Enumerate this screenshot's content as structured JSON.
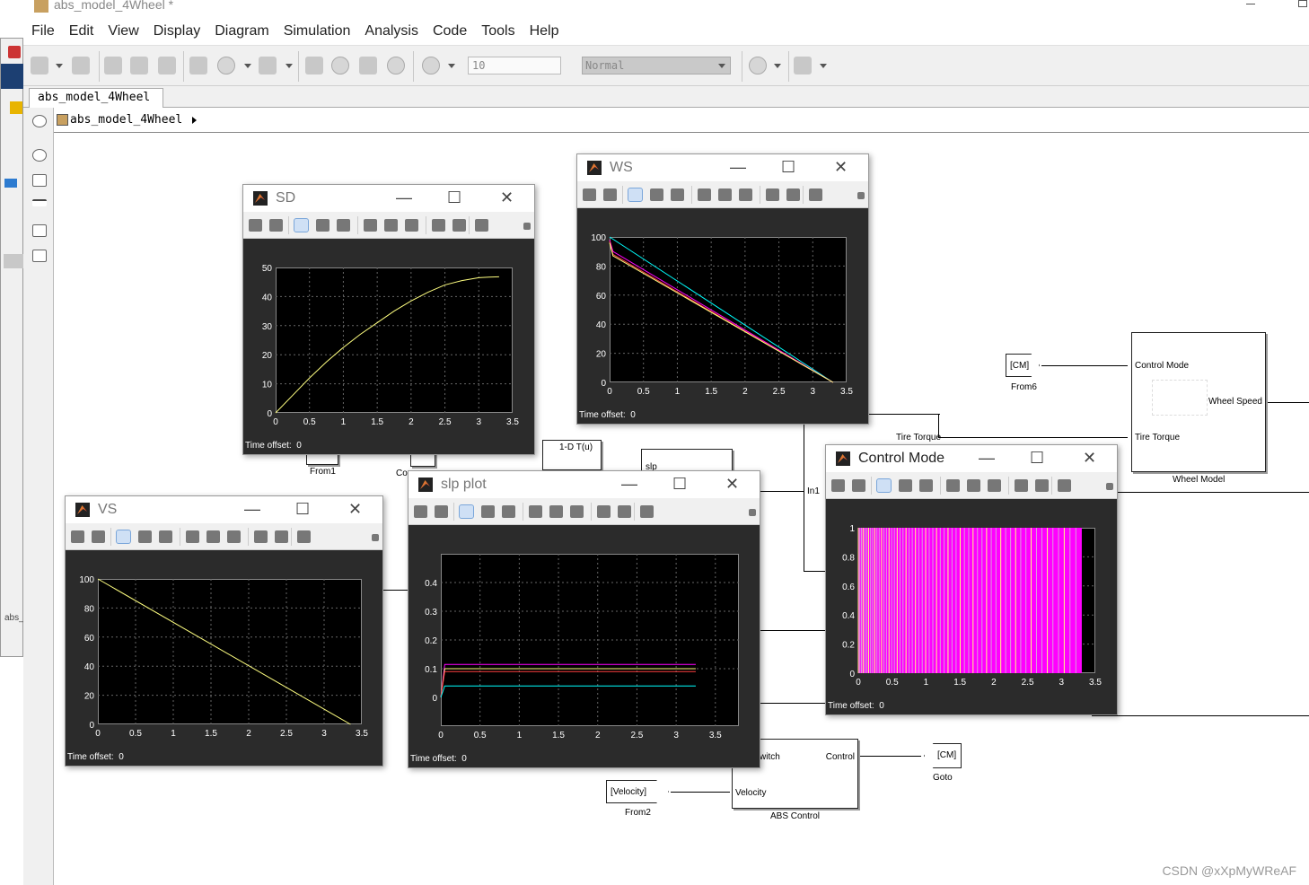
{
  "window": {
    "title": "abs_model_4Wheel *"
  },
  "menu": [
    "File",
    "Edit",
    "View",
    "Display",
    "Diagram",
    "Simulation",
    "Analysis",
    "Code",
    "Tools",
    "Help"
  ],
  "toolbar": {
    "stop_time": "10",
    "sim_mode": "Normal"
  },
  "tab": {
    "label": "abs_model_4Wheel"
  },
  "breadcrumb": {
    "label": "abs_model_4Wheel"
  },
  "blocks": {
    "from6_tag": "[CM]",
    "from6_name": "From6",
    "from1_name": "From1",
    "co_name": "Co",
    "lookup_label": "1-D T(u)",
    "slp_fragment": "slp",
    "in1": "In1",
    "tire_torque_sig": "Tire Torque",
    "wheel_model": {
      "name": "Wheel Model",
      "in1": "Control Mode",
      "in2": "Tire Torque",
      "out": "Wheel Speed"
    },
    "abs_control": {
      "name": "ABS Control",
      "in1": "witch",
      "in2": "Velocity",
      "out": "Control"
    },
    "goto": {
      "tag": "[CM]",
      "name": "Goto"
    },
    "from2": {
      "tag": "[Velocity]",
      "name": "From2"
    }
  },
  "scopes": {
    "sd": {
      "title": "SD",
      "offset_label": "Time offset:",
      "offset": "0"
    },
    "ws": {
      "title": "WS",
      "offset_label": "Time offset:",
      "offset": "0"
    },
    "vs": {
      "title": "VS",
      "offset_label": "Time offset:",
      "offset": "0"
    },
    "slp": {
      "title": "slp plot",
      "offset_label": "Time offset:",
      "offset": "0"
    },
    "cm": {
      "title": "Control Mode",
      "offset_label": "Time offset:",
      "offset": "0"
    }
  },
  "chart_data": [
    {
      "type": "line",
      "title": "SD",
      "xlim": [
        0,
        3.5
      ],
      "ylim": [
        0,
        50
      ],
      "x_ticks": [
        "0",
        "0.5",
        "1",
        "1.5",
        "2",
        "2.5",
        "3",
        "3.5"
      ],
      "y_ticks": [
        "0",
        "10",
        "20",
        "30",
        "40",
        "50"
      ],
      "grid": true,
      "colors": [
        "#ffff80"
      ],
      "series": [
        {
          "x": [
            0,
            0.25,
            0.5,
            0.75,
            1,
            1.25,
            1.5,
            1.75,
            2,
            2.25,
            2.5,
            2.75,
            3,
            3.15,
            3.3
          ],
          "values": [
            0,
            6,
            12,
            17.5,
            22.5,
            27,
            31,
            35,
            38.5,
            41.5,
            44,
            45.5,
            46.5,
            46.7,
            46.8
          ]
        }
      ]
    },
    {
      "type": "line",
      "title": "WS",
      "xlim": [
        0,
        3.5
      ],
      "ylim": [
        0,
        100
      ],
      "x_ticks": [
        "0",
        "0.5",
        "1",
        "1.5",
        "2",
        "2.5",
        "3",
        "3.5"
      ],
      "y_ticks": [
        "0",
        "20",
        "40",
        "60",
        "80",
        "100"
      ],
      "grid": true,
      "colors": [
        "#00ffff",
        "#ff00ff",
        "#ff4040",
        "#ffff80"
      ],
      "series": [
        {
          "x": [
            0,
            3.3
          ],
          "values": [
            100,
            0
          ]
        },
        {
          "x": [
            0,
            0.05,
            3.3
          ],
          "values": [
            98,
            90,
            0
          ]
        },
        {
          "x": [
            0,
            0.05,
            3.3
          ],
          "values": [
            97,
            88,
            0
          ]
        },
        {
          "x": [
            0,
            0.05,
            3.3
          ],
          "values": [
            96,
            87,
            0
          ]
        }
      ]
    },
    {
      "type": "line",
      "title": "VS",
      "xlim": [
        0,
        3.5
      ],
      "ylim": [
        0,
        100
      ],
      "x_ticks": [
        "0",
        "0.5",
        "1",
        "1.5",
        "2",
        "2.5",
        "3",
        "3.5"
      ],
      "y_ticks": [
        "0",
        "20",
        "40",
        "60",
        "80",
        "100"
      ],
      "grid": true,
      "colors": [
        "#ffff80"
      ],
      "series": [
        {
          "x": [
            0,
            3.35
          ],
          "values": [
            100,
            0
          ]
        }
      ]
    },
    {
      "type": "line",
      "title": "slp plot",
      "xlim": [
        0,
        3.8
      ],
      "ylim": [
        -0.1,
        0.5
      ],
      "x_ticks": [
        "0",
        "0.5",
        "1",
        "1.5",
        "2",
        "2.5",
        "3",
        "3.5"
      ],
      "y_ticks": [
        "0",
        "0.1",
        "0.2",
        "0.3",
        "0.4"
      ],
      "grid": true,
      "colors": [
        "#ff00ff",
        "#ffff80",
        "#ff4040",
        "#00ffff"
      ],
      "series": [
        {
          "x": [
            0,
            0.05,
            3.25
          ],
          "values": [
            0,
            0.115,
            0.115
          ]
        },
        {
          "x": [
            0,
            0.05,
            3.25
          ],
          "values": [
            0,
            0.1,
            0.1
          ]
        },
        {
          "x": [
            0,
            0.05,
            3.25
          ],
          "values": [
            0,
            0.09,
            0.09
          ]
        },
        {
          "x": [
            0,
            0.05,
            3.25
          ],
          "values": [
            0,
            0.04,
            0.04
          ]
        }
      ]
    },
    {
      "type": "area",
      "title": "Control Mode",
      "xlim": [
        0,
        3.5
      ],
      "ylim": [
        0,
        1
      ],
      "x_ticks": [
        "0",
        "0.5",
        "1",
        "1.5",
        "2",
        "2.5",
        "3",
        "3.5"
      ],
      "y_ticks": [
        "0",
        "0.2",
        "0.4",
        "0.6",
        "0.8",
        "1"
      ],
      "grid": true,
      "colors": [
        "#ff00ff",
        "#ffff80"
      ],
      "series": [
        {
          "x": [
            0,
            3.3
          ],
          "values": [
            1,
            1
          ]
        }
      ]
    }
  ],
  "watermark": "CSDN @xXpMyWReAF"
}
